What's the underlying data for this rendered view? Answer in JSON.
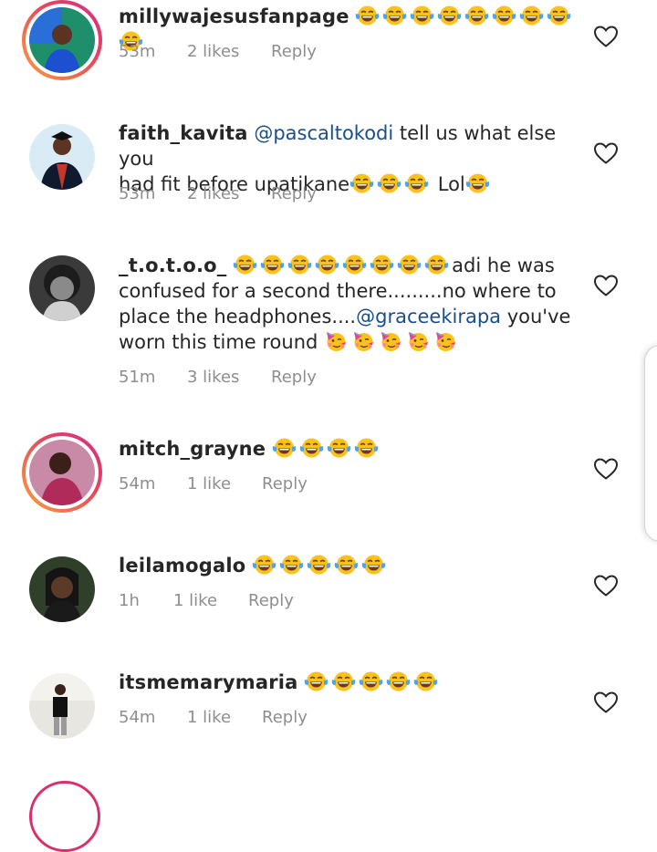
{
  "colors": {
    "text": "#262626",
    "meta": "#8e8e8e",
    "mention": "#1a4f8b",
    "story_ring": "#e8455c"
  },
  "icons": {
    "laugh": "face-with-tears-of-joy-icon",
    "party": "partying-face-icon",
    "heart": "heart-outline-icon"
  },
  "comments": [
    {
      "username": "millywajesusfanpage",
      "pre": "",
      "mention": "",
      "text": "",
      "laugh_count": 9,
      "time": "53m",
      "likes": "2 likes",
      "reply": "Reply",
      "story_ring": true
    },
    {
      "username": "faith_kavita",
      "mention": "@pascaltokodi",
      "text_a": "tell us what else you",
      "text_b": "had fit before upatikane",
      "laugh_count": 3,
      "text_c": "Lol",
      "time": "53m",
      "likes": "2 likes",
      "reply": "Reply"
    },
    {
      "username": "_t.o.t.o.o_",
      "laugh_count": 8,
      "line1_text": "adi he was",
      "line2": "confused  for a second  there.........no where to",
      "line3_text": "place  the headphones....",
      "mention": "@graceekirapa",
      "line3_after": "you've",
      "line4_text": "worn this time round",
      "party_count": 5,
      "time": "51m",
      "likes": "3 likes",
      "reply": "Reply"
    },
    {
      "username": "mitch_grayne",
      "laugh_count": 4,
      "time": "54m",
      "likes": "1 like",
      "reply": "Reply",
      "story_ring": true
    },
    {
      "username": "leilamogalo",
      "laugh_count": 5,
      "time": "1h",
      "likes": "1 like",
      "reply": "Reply"
    },
    {
      "username": "itsmemarymaria",
      "laugh_count": 5,
      "time": "54m",
      "likes": "1 like",
      "reply": "Reply"
    }
  ]
}
